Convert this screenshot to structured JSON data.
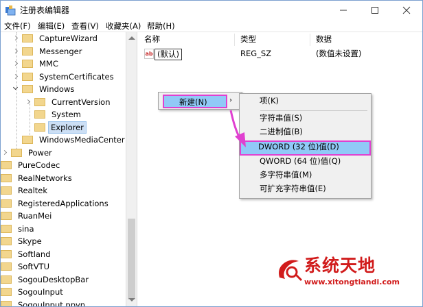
{
  "window": {
    "title": "注册表编辑器",
    "icon": "regedit-icon",
    "controls": [
      "minimize-icon",
      "maximize-icon",
      "close-icon"
    ]
  },
  "menu": [
    "文件(F)",
    "编辑(E)",
    "查看(V)",
    "收藏夹(A)",
    "帮助(H)"
  ],
  "tree": {
    "nodes": [
      {
        "label": "CaptureWizard",
        "depth": 2,
        "expander": "right"
      },
      {
        "label": "Messenger",
        "depth": 2,
        "expander": "right"
      },
      {
        "label": "MMC",
        "depth": 2,
        "expander": "right"
      },
      {
        "label": "SystemCertificates",
        "depth": 2,
        "expander": "right"
      },
      {
        "label": "Windows",
        "depth": 2,
        "expander": "down"
      },
      {
        "label": "CurrentVersion",
        "depth": 3,
        "expander": "right"
      },
      {
        "label": "System",
        "depth": 3,
        "expander": "none"
      },
      {
        "label": "Explorer",
        "depth": 3,
        "expander": "none",
        "selected": true
      },
      {
        "label": "WindowsMediaCenter",
        "depth": 2,
        "expander": "none"
      },
      {
        "label": "Power",
        "depth": 1,
        "expander": "right"
      },
      {
        "label": "PureCodec",
        "depth": 0,
        "expander": "none"
      },
      {
        "label": "RealNetworks",
        "depth": 0,
        "expander": "none"
      },
      {
        "label": "Realtek",
        "depth": 0,
        "expander": "none"
      },
      {
        "label": "RegisteredApplications",
        "depth": 0,
        "expander": "none"
      },
      {
        "label": "RuanMei",
        "depth": 0,
        "expander": "none"
      },
      {
        "label": "sina",
        "depth": 0,
        "expander": "none"
      },
      {
        "label": "Skype",
        "depth": 0,
        "expander": "none"
      },
      {
        "label": "Softland",
        "depth": 0,
        "expander": "none"
      },
      {
        "label": "SoftVTU",
        "depth": 0,
        "expander": "none"
      },
      {
        "label": "SogouDesktopBar",
        "depth": 0,
        "expander": "none"
      },
      {
        "label": "SogouInput",
        "depth": 0,
        "expander": "none"
      },
      {
        "label": "SogouInput.ppvn",
        "depth": 0,
        "expander": "none"
      }
    ]
  },
  "list": {
    "columns": [
      "名称",
      "类型",
      "数据"
    ],
    "rows": [
      {
        "icon": "string-value-icon",
        "icon_text": "ab",
        "name": "(默认)",
        "type": "REG_SZ",
        "data": "(数值未设置)"
      }
    ]
  },
  "context_menu": {
    "new_label": "新建(N)",
    "new_arrow": "›",
    "submenu": [
      {
        "label": "项(K)"
      },
      {
        "separator": true
      },
      {
        "label": "字符串值(S)"
      },
      {
        "label": "二进制值(B)"
      },
      {
        "label": "DWORD (32 位)值(D)",
        "highlighted": true
      },
      {
        "label": "QWORD (64 位)值(Q)"
      },
      {
        "label": "多字符串值(M)"
      },
      {
        "label": "可扩充字符串值(E)"
      }
    ]
  },
  "watermark": {
    "name": "系统天地",
    "url": "www.xitongtiandi.com"
  },
  "colors": {
    "highlight": "#91c9f7",
    "annotation": "#e040d0",
    "folder": "#f2d68e",
    "watermark": "#d11b1b"
  }
}
